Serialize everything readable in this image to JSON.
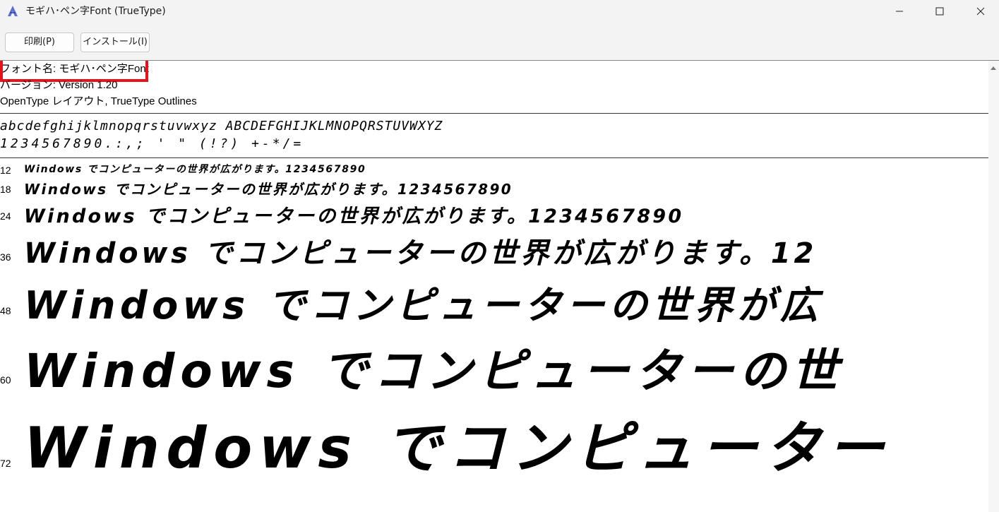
{
  "window": {
    "title": "モギハ･ペン字Font (TrueType)",
    "icon": "font-viewer-app-icon"
  },
  "toolbar": {
    "print_label": "印刷(P)",
    "install_label": "インストール(I)"
  },
  "info": {
    "font_name": "フォント名: モギハ･ペン字Font",
    "version": "バージョン: Version 1.20",
    "type": "OpenType レイアウト, TrueType Outlines"
  },
  "charset": {
    "letters": "abcdefghijklmnopqrstuvwxyz ABCDEFGHIJKLMNOPQRSTUVWXYZ",
    "digits_symbols": "1234567890.:,; ' \" (!?) +-*/="
  },
  "samples": [
    {
      "size": "12",
      "text": "Windows でコンピューターの世界が広がります。1234567890"
    },
    {
      "size": "18",
      "text": "Windows でコンピューターの世界が広がります。1234567890"
    },
    {
      "size": "24",
      "text": "Windows でコンピューターの世界が広がります。1234567890"
    },
    {
      "size": "36",
      "text": "Windows でコンピューターの世界が広がります。12"
    },
    {
      "size": "48",
      "text": "Windows でコンピューターの世界が広"
    },
    {
      "size": "60",
      "text": "Windows でコンピューターの世"
    },
    {
      "size": "72",
      "text": "Windows でコンピューター"
    }
  ],
  "colors": {
    "highlight": "#e8121b",
    "titlebar": "#f3f3f3"
  }
}
